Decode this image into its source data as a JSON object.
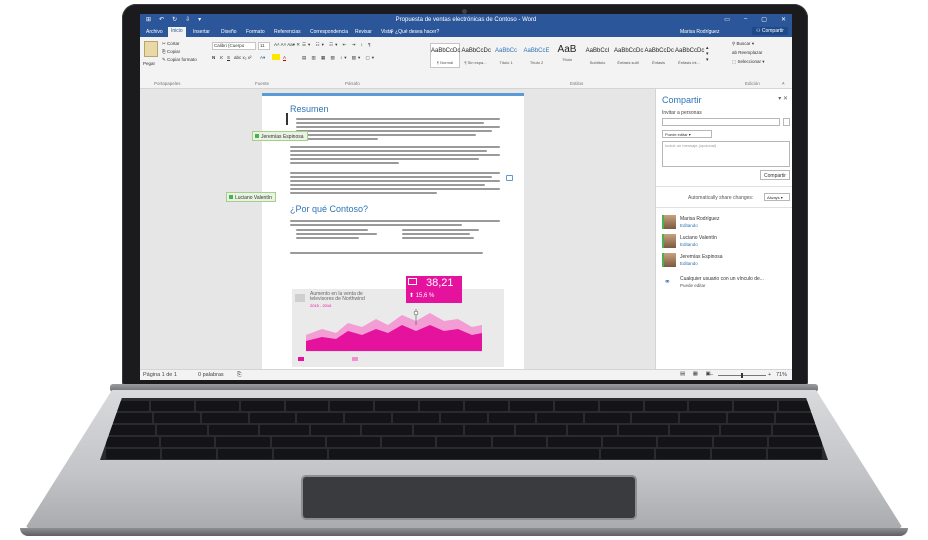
{
  "window": {
    "title": "Propuesta de ventas electrónicas de Contoso - Word",
    "qat": [
      "⊞",
      "↶",
      "↻",
      "⇩",
      "▾"
    ],
    "controls": [
      "▭",
      "–",
      "▢",
      "✕"
    ]
  },
  "tabs": [
    "Archivo",
    "Inicio",
    "Insertar",
    "Diseño",
    "Formato",
    "Referencias",
    "Correspondencia",
    "Revisar",
    "Vista"
  ],
  "active_tab": "Inicio",
  "tell_me": "¿Qué desea hacer?",
  "user_name": "Marisa Rodríguez",
  "share_button": "Compartir",
  "ribbon": {
    "clipboard": {
      "paste": "Pegar",
      "cut": "Cortar",
      "copy": "Copiar",
      "format_painter": "Copiar formato",
      "group": "Portapapeles"
    },
    "font": {
      "name": "Calibri (Cuerpo",
      "size": "11",
      "group": "Fuente"
    },
    "paragraph": {
      "group": "Párrafo"
    },
    "styles": {
      "group": "Estilos",
      "items": [
        {
          "sample": "AaBbCcDc",
          "name": "¶ Normal"
        },
        {
          "sample": "AaBbCcDc",
          "name": "¶ Sin espa..."
        },
        {
          "sample": "AaBbCc",
          "name": "Título 1"
        },
        {
          "sample": "AaBbCcE",
          "name": "Título 2"
        },
        {
          "sample": "AaB",
          "name": "Título"
        },
        {
          "sample": "AaBbCcI",
          "name": "Subtítulo"
        },
        {
          "sample": "AaBbCcDc",
          "name": "Énfasis sutil"
        },
        {
          "sample": "AaBbCcDc",
          "name": "Énfasis"
        },
        {
          "sample": "AaBbCcDc",
          "name": "Énfasis int..."
        }
      ]
    },
    "editing": {
      "find": "Buscar",
      "replace": "Reemplazar",
      "select": "Seleccionar",
      "group": "Edición"
    }
  },
  "document": {
    "heading1": "Resumen",
    "heading2": "¿Por qué Contoso?",
    "presence": [
      {
        "name": "Jeremías Espinosa"
      },
      {
        "name": "Luciano Valentín"
      }
    ],
    "chart": {
      "title": "Aumento en la venta de televisores de Northwind",
      "subtitle": "2015 - 2016",
      "callout_value": "38,21",
      "callout_percent": "15,6 %"
    }
  },
  "share_pane": {
    "title": "Compartir",
    "invite_label": "Invitar a personas",
    "permission": "Puede editar",
    "message_placeholder": "Incluir un mensaje (opcional)",
    "share_button": "Compartir",
    "auto_share_label": "Automatically share changes:",
    "auto_share_value": "Always",
    "people": [
      {
        "name": "Marisa Rodríguez",
        "status": "Editando"
      },
      {
        "name": "Luciano Valentín",
        "status": "Editando"
      },
      {
        "name": "Jeremías Espinosa",
        "status": "Editando"
      }
    ],
    "link_text": "Cualquier usuario con un vínculo de...",
    "link_status": "Puede editar"
  },
  "statusbar": {
    "page": "Página 1 de 1",
    "words": "0 palabras",
    "zoom": "71%"
  },
  "colors": {
    "word_blue": "#2b579a",
    "heading_blue": "#2e74b5",
    "chart_magenta": "#e5129d",
    "presence_green": "#4caf50"
  }
}
